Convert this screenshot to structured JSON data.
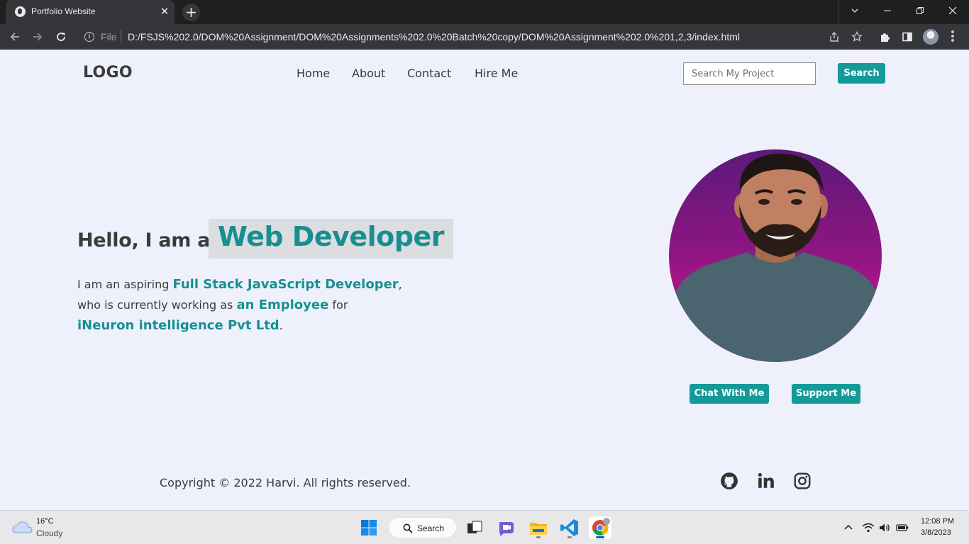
{
  "browser": {
    "tab_title": "Portfolio Website",
    "tab_close": "✕",
    "new_tab": "+",
    "url_scheme": "File",
    "url": "D:/FSJS%202.0/DOM%20Assignment/DOM%20Assignments%202.0%20Batch%20copy/DOM%20Assignment%202.0%201,2,3/index.html"
  },
  "site": {
    "logo": "LOGO",
    "nav": [
      "Home",
      "About",
      "Contact",
      "Hire Me"
    ],
    "search_placeholder": "Search My Project",
    "search_button": "Search",
    "hero": {
      "intro": "Hello, I am a",
      "role": "Web Developer",
      "para_1": "I am an aspiring ",
      "hl_1": "Full Stack JavaScript Developer",
      "para_2": ",",
      "para_3": "who is currently working as ",
      "hl_2": "an Employee",
      "para_4": " for",
      "hl_3": "iNeuron intelligence Pvt Ltd",
      "para_5": "."
    },
    "buttons": {
      "chat": "Chat With Me",
      "support": "Support Me"
    },
    "footer": {
      "copyright": "Copyright © 2022 Harvi. All rights reserved."
    }
  },
  "taskbar": {
    "weather_temp": "16°C",
    "weather_desc": "Cloudy",
    "search_label": "Search",
    "time": "12:08 PM",
    "date": "3/8/2023"
  },
  "colors": {
    "accent": "#159a9a",
    "page_bg": "#eef1fb",
    "text": "#3b3b3b"
  }
}
